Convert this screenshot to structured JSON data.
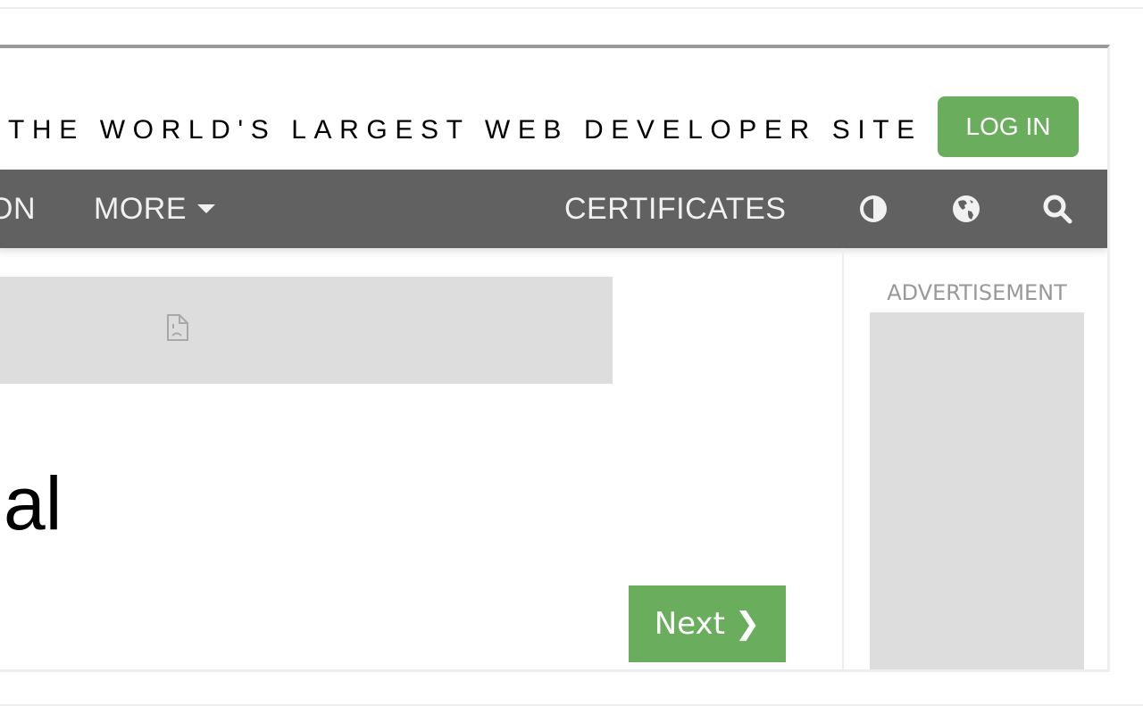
{
  "header": {
    "tagline": "THE WORLD'S LARGEST WEB DEVELOPER SITE",
    "login_label": "LOG IN"
  },
  "navbar": {
    "items": [
      {
        "label": "ON",
        "partial": true
      },
      {
        "label": "MORE",
        "has_dropdown": true,
        "icon": "caret-down-icon"
      },
      {
        "label": "CERTIFICATES"
      }
    ],
    "icons": [
      "contrast-icon",
      "globe-icon",
      "search-icon"
    ]
  },
  "main": {
    "banner_icon": "broken-image-icon",
    "heading_partial": "al",
    "next_label": "Next ❯"
  },
  "sidebar": {
    "ad_label": "ADVERTISEMENT"
  },
  "colors": {
    "brand_green": "#6aae5d",
    "navbar_bg": "#616161",
    "placeholder_gray": "#dddddd"
  }
}
